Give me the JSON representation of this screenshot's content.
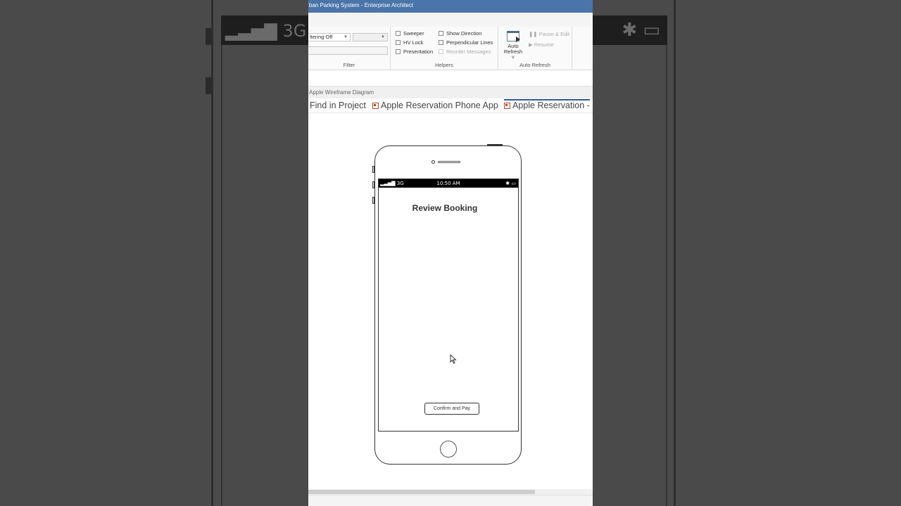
{
  "background": {
    "status_left": "▂▃▅▇ 3G",
    "status_right": "✱ ▭"
  },
  "window": {
    "title": "ban Parking System - Enterprise Architect"
  },
  "ribbon": {
    "filter": {
      "select_value": "ltering Off",
      "label": "Filter"
    },
    "helpers": {
      "label": "Helpers",
      "checkboxes": [
        {
          "label": "Sweeper",
          "enabled": true
        },
        {
          "label": "HV Lock",
          "enabled": true
        },
        {
          "label": "Presentation",
          "enabled": true
        },
        {
          "label": "Show Direction",
          "enabled": true
        },
        {
          "label": "Perpendicular Lines",
          "enabled": true
        },
        {
          "label": "Reorder Messages",
          "enabled": false
        }
      ]
    },
    "auto_refresh": {
      "label": "Auto Refresh",
      "button_line1": "Auto",
      "button_line2": "Refresh ˅",
      "pause": "Pause & Edit",
      "resume": "Resume"
    }
  },
  "breadcrumb": "Apple Wireframe Diagram",
  "doc_tabs": [
    {
      "label": "Find in Project",
      "icon": "none",
      "active": false
    },
    {
      "label": "Apple Reservation Phone App",
      "icon": "diagram-icon",
      "active": false
    },
    {
      "label": "Apple Reservation -",
      "icon": "diagram-icon",
      "active": true
    }
  ],
  "phone": {
    "status_signal": "▂▃▅▇ 3G",
    "status_time": "10:50 AM",
    "status_icons": "✱ ▭",
    "screen_title": "Review Booking",
    "confirm_button": "Confirm and Pay"
  }
}
